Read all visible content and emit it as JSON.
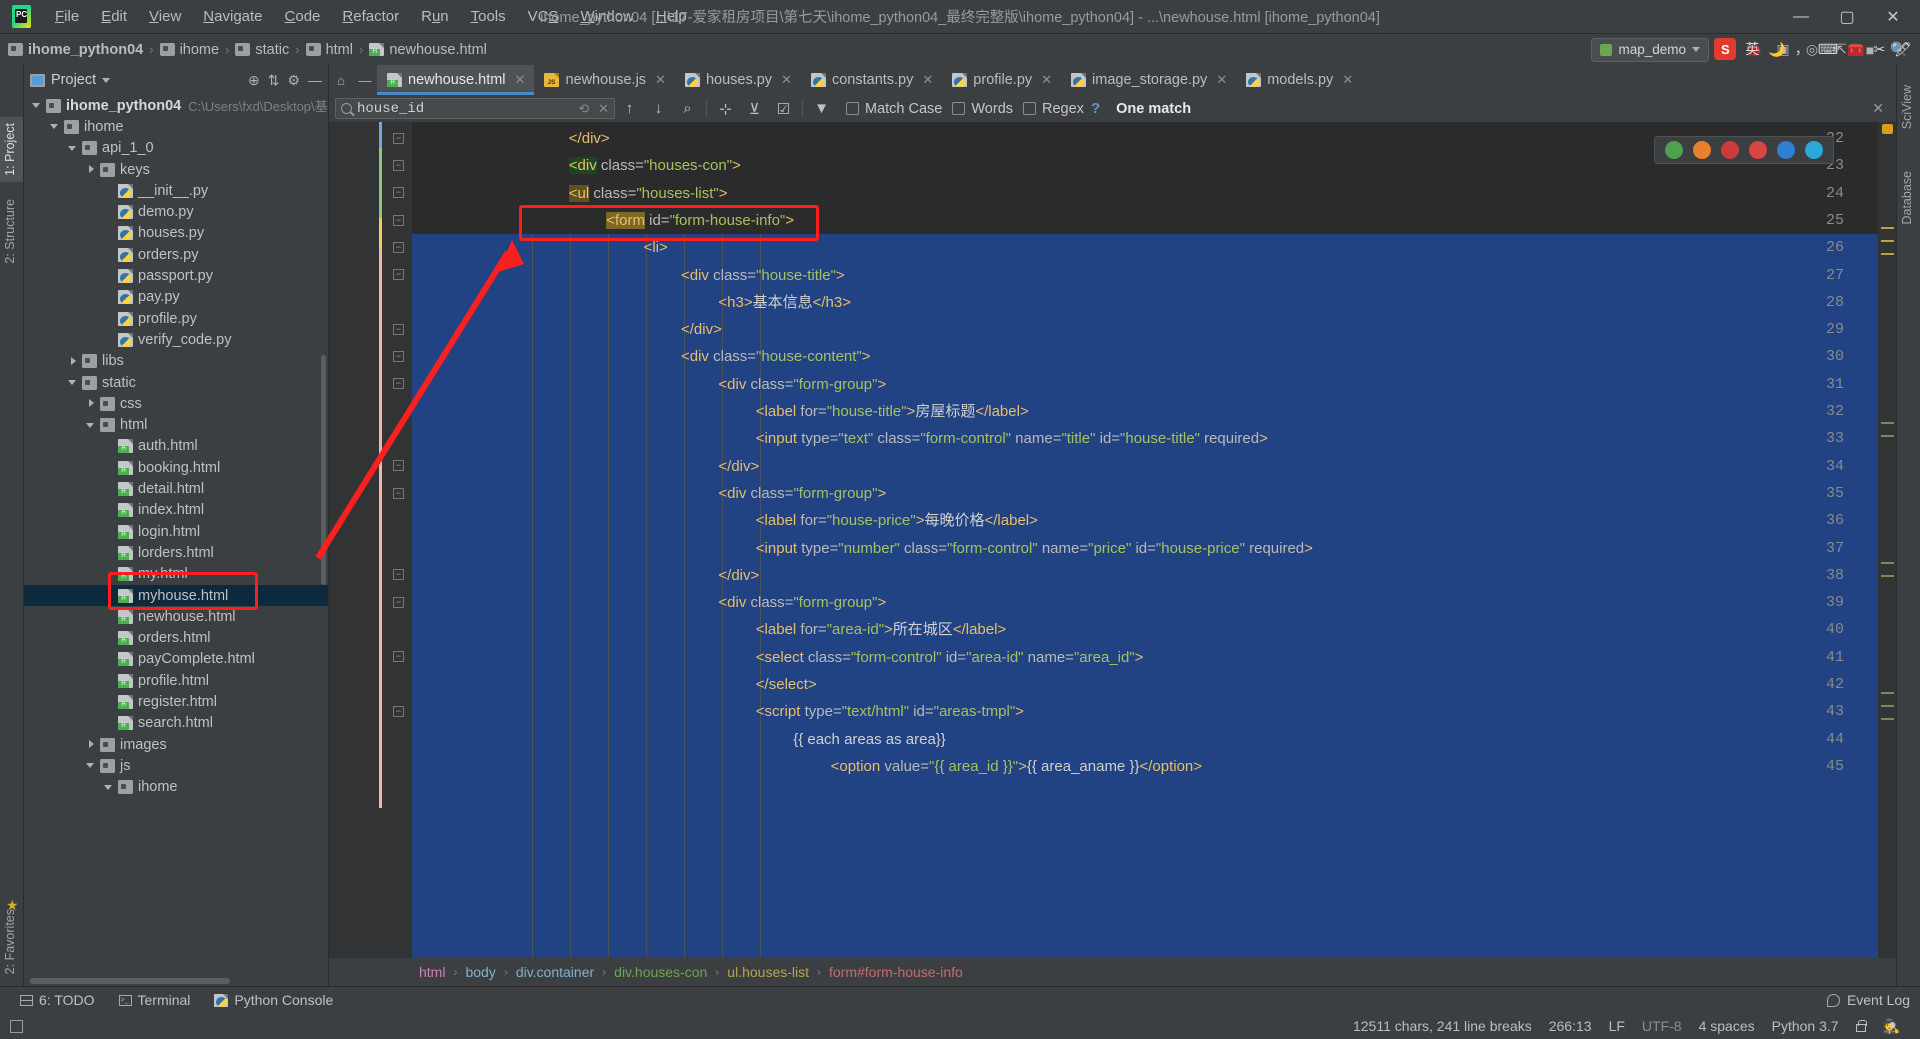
{
  "window": {
    "title": "ihome_python04 [...\\17-爱家租房项目\\第七天\\ihome_python04_最终完整版\\ihome_python04] - ...\\newhouse.html [ihome_python04]",
    "minimize": "—",
    "maximize": "▢",
    "close": "✕"
  },
  "menu": [
    {
      "label": "File"
    },
    {
      "label": "Edit"
    },
    {
      "label": "View"
    },
    {
      "label": "Navigate"
    },
    {
      "label": "Code"
    },
    {
      "label": "Refactor"
    },
    {
      "label": "Run"
    },
    {
      "label": "Tools"
    },
    {
      "label": "VCS"
    },
    {
      "label": "Window"
    },
    {
      "label": "Help"
    }
  ],
  "navbar": {
    "breadcrumb": [
      {
        "label": "ihome_python04",
        "icon": "folder-icon",
        "bold": true
      },
      {
        "label": "ihome",
        "icon": "folder-icon"
      },
      {
        "label": "static",
        "icon": "folder-icon"
      },
      {
        "label": "html",
        "icon": "folder-icon"
      },
      {
        "label": "newhouse.html",
        "icon": "html-file-icon"
      }
    ],
    "separator": "›",
    "run_config": "map_demo",
    "buttons": [
      "run",
      "debug",
      "coverage",
      "profile",
      "attach",
      "stop",
      "search"
    ]
  },
  "left_rail": [
    {
      "label": "1: Project",
      "selected": true
    },
    {
      "label": "2: Structure",
      "selected": false
    },
    {
      "label": "2:",
      "selected": false
    }
  ],
  "bottom_left_rail": [
    {
      "label": "2: Favorites"
    }
  ],
  "right_rail": [
    {
      "label": "SciView"
    },
    {
      "label": "Database"
    }
  ],
  "project_panel": {
    "title": "Project",
    "tree": [
      {
        "indent": 0,
        "arrow": "open",
        "icon": "folder-icon",
        "label": "ihome_python04",
        "bold": true,
        "path": "C:\\Users\\fxd\\Desktop\\基础"
      },
      {
        "indent": 1,
        "arrow": "open",
        "icon": "folder-icon",
        "label": "ihome"
      },
      {
        "indent": 2,
        "arrow": "open",
        "icon": "folder-icon",
        "label": "api_1_0"
      },
      {
        "indent": 3,
        "arrow": "closed",
        "icon": "folder-icon",
        "label": "keys"
      },
      {
        "indent": 4,
        "arrow": "none",
        "icon": "python-file-icon",
        "label": "__init__.py"
      },
      {
        "indent": 4,
        "arrow": "none",
        "icon": "python-file-icon",
        "label": "demo.py"
      },
      {
        "indent": 4,
        "arrow": "none",
        "icon": "python-file-icon",
        "label": "houses.py"
      },
      {
        "indent": 4,
        "arrow": "none",
        "icon": "python-file-icon",
        "label": "orders.py"
      },
      {
        "indent": 4,
        "arrow": "none",
        "icon": "python-file-icon",
        "label": "passport.py"
      },
      {
        "indent": 4,
        "arrow": "none",
        "icon": "python-file-icon",
        "label": "pay.py"
      },
      {
        "indent": 4,
        "arrow": "none",
        "icon": "python-file-icon",
        "label": "profile.py"
      },
      {
        "indent": 4,
        "arrow": "none",
        "icon": "python-file-icon",
        "label": "verify_code.py"
      },
      {
        "indent": 2,
        "arrow": "closed",
        "icon": "folder-icon",
        "label": "libs"
      },
      {
        "indent": 2,
        "arrow": "open",
        "icon": "folder-icon",
        "label": "static"
      },
      {
        "indent": 3,
        "arrow": "closed",
        "icon": "folder-icon",
        "label": "css"
      },
      {
        "indent": 3,
        "arrow": "open",
        "icon": "folder-icon",
        "label": "html"
      },
      {
        "indent": 4,
        "arrow": "none",
        "icon": "html-file-icon",
        "label": "auth.html"
      },
      {
        "indent": 4,
        "arrow": "none",
        "icon": "html-file-icon",
        "label": "booking.html"
      },
      {
        "indent": 4,
        "arrow": "none",
        "icon": "html-file-icon",
        "label": "detail.html"
      },
      {
        "indent": 4,
        "arrow": "none",
        "icon": "html-file-icon",
        "label": "index.html"
      },
      {
        "indent": 4,
        "arrow": "none",
        "icon": "html-file-icon",
        "label": "login.html"
      },
      {
        "indent": 4,
        "arrow": "none",
        "icon": "html-file-icon",
        "label": "lorders.html"
      },
      {
        "indent": 4,
        "arrow": "none",
        "icon": "html-file-icon",
        "label": "my.html"
      },
      {
        "indent": 4,
        "arrow": "none",
        "icon": "html-file-icon",
        "label": "myhouse.html",
        "selected": true
      },
      {
        "indent": 4,
        "arrow": "none",
        "icon": "html-file-icon",
        "label": "newhouse.html"
      },
      {
        "indent": 4,
        "arrow": "none",
        "icon": "html-file-icon",
        "label": "orders.html"
      },
      {
        "indent": 4,
        "arrow": "none",
        "icon": "html-file-icon",
        "label": "payComplete.html"
      },
      {
        "indent": 4,
        "arrow": "none",
        "icon": "html-file-icon",
        "label": "profile.html"
      },
      {
        "indent": 4,
        "arrow": "none",
        "icon": "html-file-icon",
        "label": "register.html"
      },
      {
        "indent": 4,
        "arrow": "none",
        "icon": "html-file-icon",
        "label": "search.html"
      },
      {
        "indent": 3,
        "arrow": "closed",
        "icon": "folder-icon",
        "label": "images"
      },
      {
        "indent": 3,
        "arrow": "open",
        "icon": "folder-icon",
        "label": "js"
      },
      {
        "indent": 4,
        "arrow": "open",
        "icon": "folder-icon",
        "label": "ihome"
      }
    ]
  },
  "tabs": [
    {
      "label": "newhouse.html",
      "icon": "html-file-icon",
      "active": true
    },
    {
      "label": "newhouse.js",
      "icon": "js-file-icon",
      "active": false
    },
    {
      "label": "houses.py",
      "icon": "python-file-icon",
      "active": false
    },
    {
      "label": "constants.py",
      "icon": "python-file-icon",
      "active": false
    },
    {
      "label": "profile.py",
      "icon": "python-file-icon",
      "active": false
    },
    {
      "label": "image_storage.py",
      "icon": "python-file-icon",
      "active": false
    },
    {
      "label": "models.py",
      "icon": "python-file-icon",
      "active": false
    }
  ],
  "find": {
    "query": "house_id",
    "placeholder": "Search",
    "match_case": "Match Case",
    "words": "Words",
    "regex": "Regex",
    "help": "?",
    "result": "One match",
    "close": "✕"
  },
  "editor": {
    "first_line": 22,
    "lines": [
      {
        "n": 22,
        "indent": 8,
        "html": "<span class=\"t-tag\">&lt;/div&gt;</span>"
      },
      {
        "n": 23,
        "indent": 8,
        "html": "<span class=\"t-tag hl-green\">&lt;div</span><span class=\"t-attr\"> class=</span><span class=\"t-str\">\"houses-con\"</span><span class=\"t-tag\">&gt;</span>"
      },
      {
        "n": 24,
        "indent": 8,
        "html": "<span class=\"t-tag hl-olive\">&lt;ul</span><span class=\"t-attr\"> class=</span><span class=\"t-str\">\"houses-list\"</span><span class=\"t-tag\">&gt;</span>"
      },
      {
        "n": 25,
        "indent": 12,
        "html": "<span class=\"t-tag hl-mark\">&lt;form</span><span class=\"t-attr\"> id=</span><span class=\"t-str\">\"form-house-info\"</span><span class=\"t-tag\">&gt;</span>"
      },
      {
        "n": 26,
        "indent": 16,
        "html": "<span class=\"t-tag\">&lt;li&gt;</span>"
      },
      {
        "n": 27,
        "indent": 20,
        "html": "<span class=\"t-tag\">&lt;div</span><span class=\"t-attr\"> class=</span><span class=\"t-str\">\"house-title\"</span><span class=\"t-tag\">&gt;</span>"
      },
      {
        "n": 28,
        "indent": 24,
        "html": "<span class=\"t-tag\">&lt;h3&gt;</span><span class=\"t-txt\">基本信息</span><span class=\"t-tag\">&lt;/h3&gt;</span>"
      },
      {
        "n": 29,
        "indent": 20,
        "html": "<span class=\"t-tag\">&lt;/div&gt;</span>"
      },
      {
        "n": 30,
        "indent": 20,
        "html": "<span class=\"t-tag\">&lt;div</span><span class=\"t-attr\"> class=</span><span class=\"t-str\">\"house-content\"</span><span class=\"t-tag\">&gt;</span>"
      },
      {
        "n": 31,
        "indent": 24,
        "html": "<span class=\"t-tag\">&lt;div</span><span class=\"t-attr\"> class=</span><span class=\"t-str\">\"form-group\"</span><span class=\"t-tag\">&gt;</span>"
      },
      {
        "n": 32,
        "indent": 28,
        "html": "<span class=\"t-tag\">&lt;label</span><span class=\"t-attr\"> for=</span><span class=\"t-str\">\"house-title\"</span><span class=\"t-tag\">&gt;</span><span class=\"t-txt\">房屋标题</span><span class=\"t-tag\">&lt;/label&gt;</span>"
      },
      {
        "n": 33,
        "indent": 28,
        "html": "<span class=\"t-tag\">&lt;input</span><span class=\"t-attr\"> type=</span><span class=\"t-str\">\"text\"</span><span class=\"t-attr\"> class=</span><span class=\"t-str\">\"form-control\"</span><span class=\"t-attr\"> name=</span><span class=\"t-str\">\"title\"</span><span class=\"t-attr\"> id=</span><span class=\"t-str\">\"house-title\"</span><span class=\"t-attr\"> required</span><span class=\"t-tag\">&gt;</span>"
      },
      {
        "n": 34,
        "indent": 24,
        "html": "<span class=\"t-tag\">&lt;/div&gt;</span>"
      },
      {
        "n": 35,
        "indent": 24,
        "html": "<span class=\"t-tag\">&lt;div</span><span class=\"t-attr\"> class=</span><span class=\"t-str\">\"form-group\"</span><span class=\"t-tag\">&gt;</span>"
      },
      {
        "n": 36,
        "indent": 28,
        "html": "<span class=\"t-tag\">&lt;label</span><span class=\"t-attr\"> for=</span><span class=\"t-str\">\"house-price\"</span><span class=\"t-tag\">&gt;</span><span class=\"t-txt\">每晚价格</span><span class=\"t-tag\">&lt;/label&gt;</span>"
      },
      {
        "n": 37,
        "indent": 28,
        "html": "<span class=\"t-tag\">&lt;input</span><span class=\"t-attr\"> type=</span><span class=\"t-str\">\"number\"</span><span class=\"t-attr\"> class=</span><span class=\"t-str\">\"form-control\"</span><span class=\"t-attr\"> name=</span><span class=\"t-str\">\"price\"</span><span class=\"t-attr\"> id=</span><span class=\"t-str\">\"house-price\"</span><span class=\"t-attr\"> required</span><span class=\"t-tag\">&gt;</span>"
      },
      {
        "n": 38,
        "indent": 24,
        "html": "<span class=\"t-tag\">&lt;/div&gt;</span>"
      },
      {
        "n": 39,
        "indent": 24,
        "html": "<span class=\"t-tag\">&lt;div</span><span class=\"t-attr\"> class=</span><span class=\"t-str\">\"form-group\"</span><span class=\"t-tag\">&gt;</span>"
      },
      {
        "n": 40,
        "indent": 28,
        "html": "<span class=\"t-tag\">&lt;label</span><span class=\"t-attr\"> for=</span><span class=\"t-str\">\"area-id\"</span><span class=\"t-tag\">&gt;</span><span class=\"t-txt\">所在城区</span><span class=\"t-tag\">&lt;/label&gt;</span>"
      },
      {
        "n": 41,
        "indent": 28,
        "html": "<span class=\"t-tag\">&lt;select</span><span class=\"t-attr\"> class=</span><span class=\"t-str\">\"form-control\"</span><span class=\"t-attr\"> id=</span><span class=\"t-str\">\"area-id\"</span><span class=\"t-attr\"> name=</span><span class=\"t-str\">\"area_id\"</span><span class=\"t-tag\">&gt;</span>"
      },
      {
        "n": 42,
        "indent": 28,
        "html": "<span class=\"t-tag\">&lt;/select&gt;</span>"
      },
      {
        "n": 43,
        "indent": 28,
        "html": "<span class=\"t-tag\">&lt;script</span><span class=\"t-attr\"> type=</span><span class=\"t-str\">\"text/html\"</span><span class=\"t-attr\"> id=</span><span class=\"t-str\">\"areas-tmpl\"</span><span class=\"t-tag\">&gt;</span>"
      },
      {
        "n": 44,
        "indent": 32,
        "html": "<span class=\"t-txt\">{{ each areas as area}}</span>"
      },
      {
        "n": 45,
        "indent": 36,
        "html": "<span class=\"t-tag\">&lt;option</span><span class=\"t-attr\"> value=</span><span class=\"t-str\">\"{{ area_id }}\"</span><span class=\"t-tag\">&gt;</span><span class=\"t-txt\">{{ area_aname }}</span><span class=\"t-tag\">&lt;/option&gt;</span>"
      }
    ]
  },
  "edit_breadcrumb": [
    {
      "label": "html",
      "color": "#cf7fb0"
    },
    {
      "label": "body",
      "color": "#7fb0cf"
    },
    {
      "label": "div.container",
      "color": "#7fb0cf"
    },
    {
      "label": "div.houses-con",
      "color": "#6aa84f"
    },
    {
      "label": "ul.houses-list",
      "color": "#b8a548"
    },
    {
      "label": "form#form-house-info",
      "color": "#c96a6a"
    }
  ],
  "tool_window_bar": {
    "items": [
      {
        "label": "6: TODO",
        "icon": "grid-icon"
      },
      {
        "label": "Terminal",
        "icon": "terminal-icon"
      },
      {
        "label": "Python Console",
        "icon": "python-icon"
      }
    ],
    "event_log": "Event Log"
  },
  "status_bar": {
    "chars": "12511 chars, 241 line breaks",
    "caret": "266:13",
    "line_sep": "LF",
    "encoding": "UTF-8",
    "indent": "4 spaces",
    "interpreter": "Python 3.7",
    "lock": "lock-icon",
    "hector": "hector-icon"
  },
  "ime": {
    "logo": "S",
    "mode": "英",
    "items": [
      "moon-icon",
      "comma-icon",
      "keyboard-icon",
      "toolbox-icon",
      "scissors-icon",
      "pen-icon"
    ]
  },
  "browser_bar": {
    "icons": [
      "chrome-icon",
      "firefox-icon",
      "opera-icon",
      "safari-icon",
      "edge-icon",
      "ie-icon"
    ],
    "colors": [
      "#4fa04f",
      "#e8802c",
      "#cc3b3b",
      "#d94545",
      "#2f7fd4",
      "#2aa8d8"
    ]
  },
  "annotations": {
    "file_box": "myhouse.html",
    "code_box": "<form id=\"form-house-info\">",
    "arrow_color": "#fc1f1f"
  }
}
